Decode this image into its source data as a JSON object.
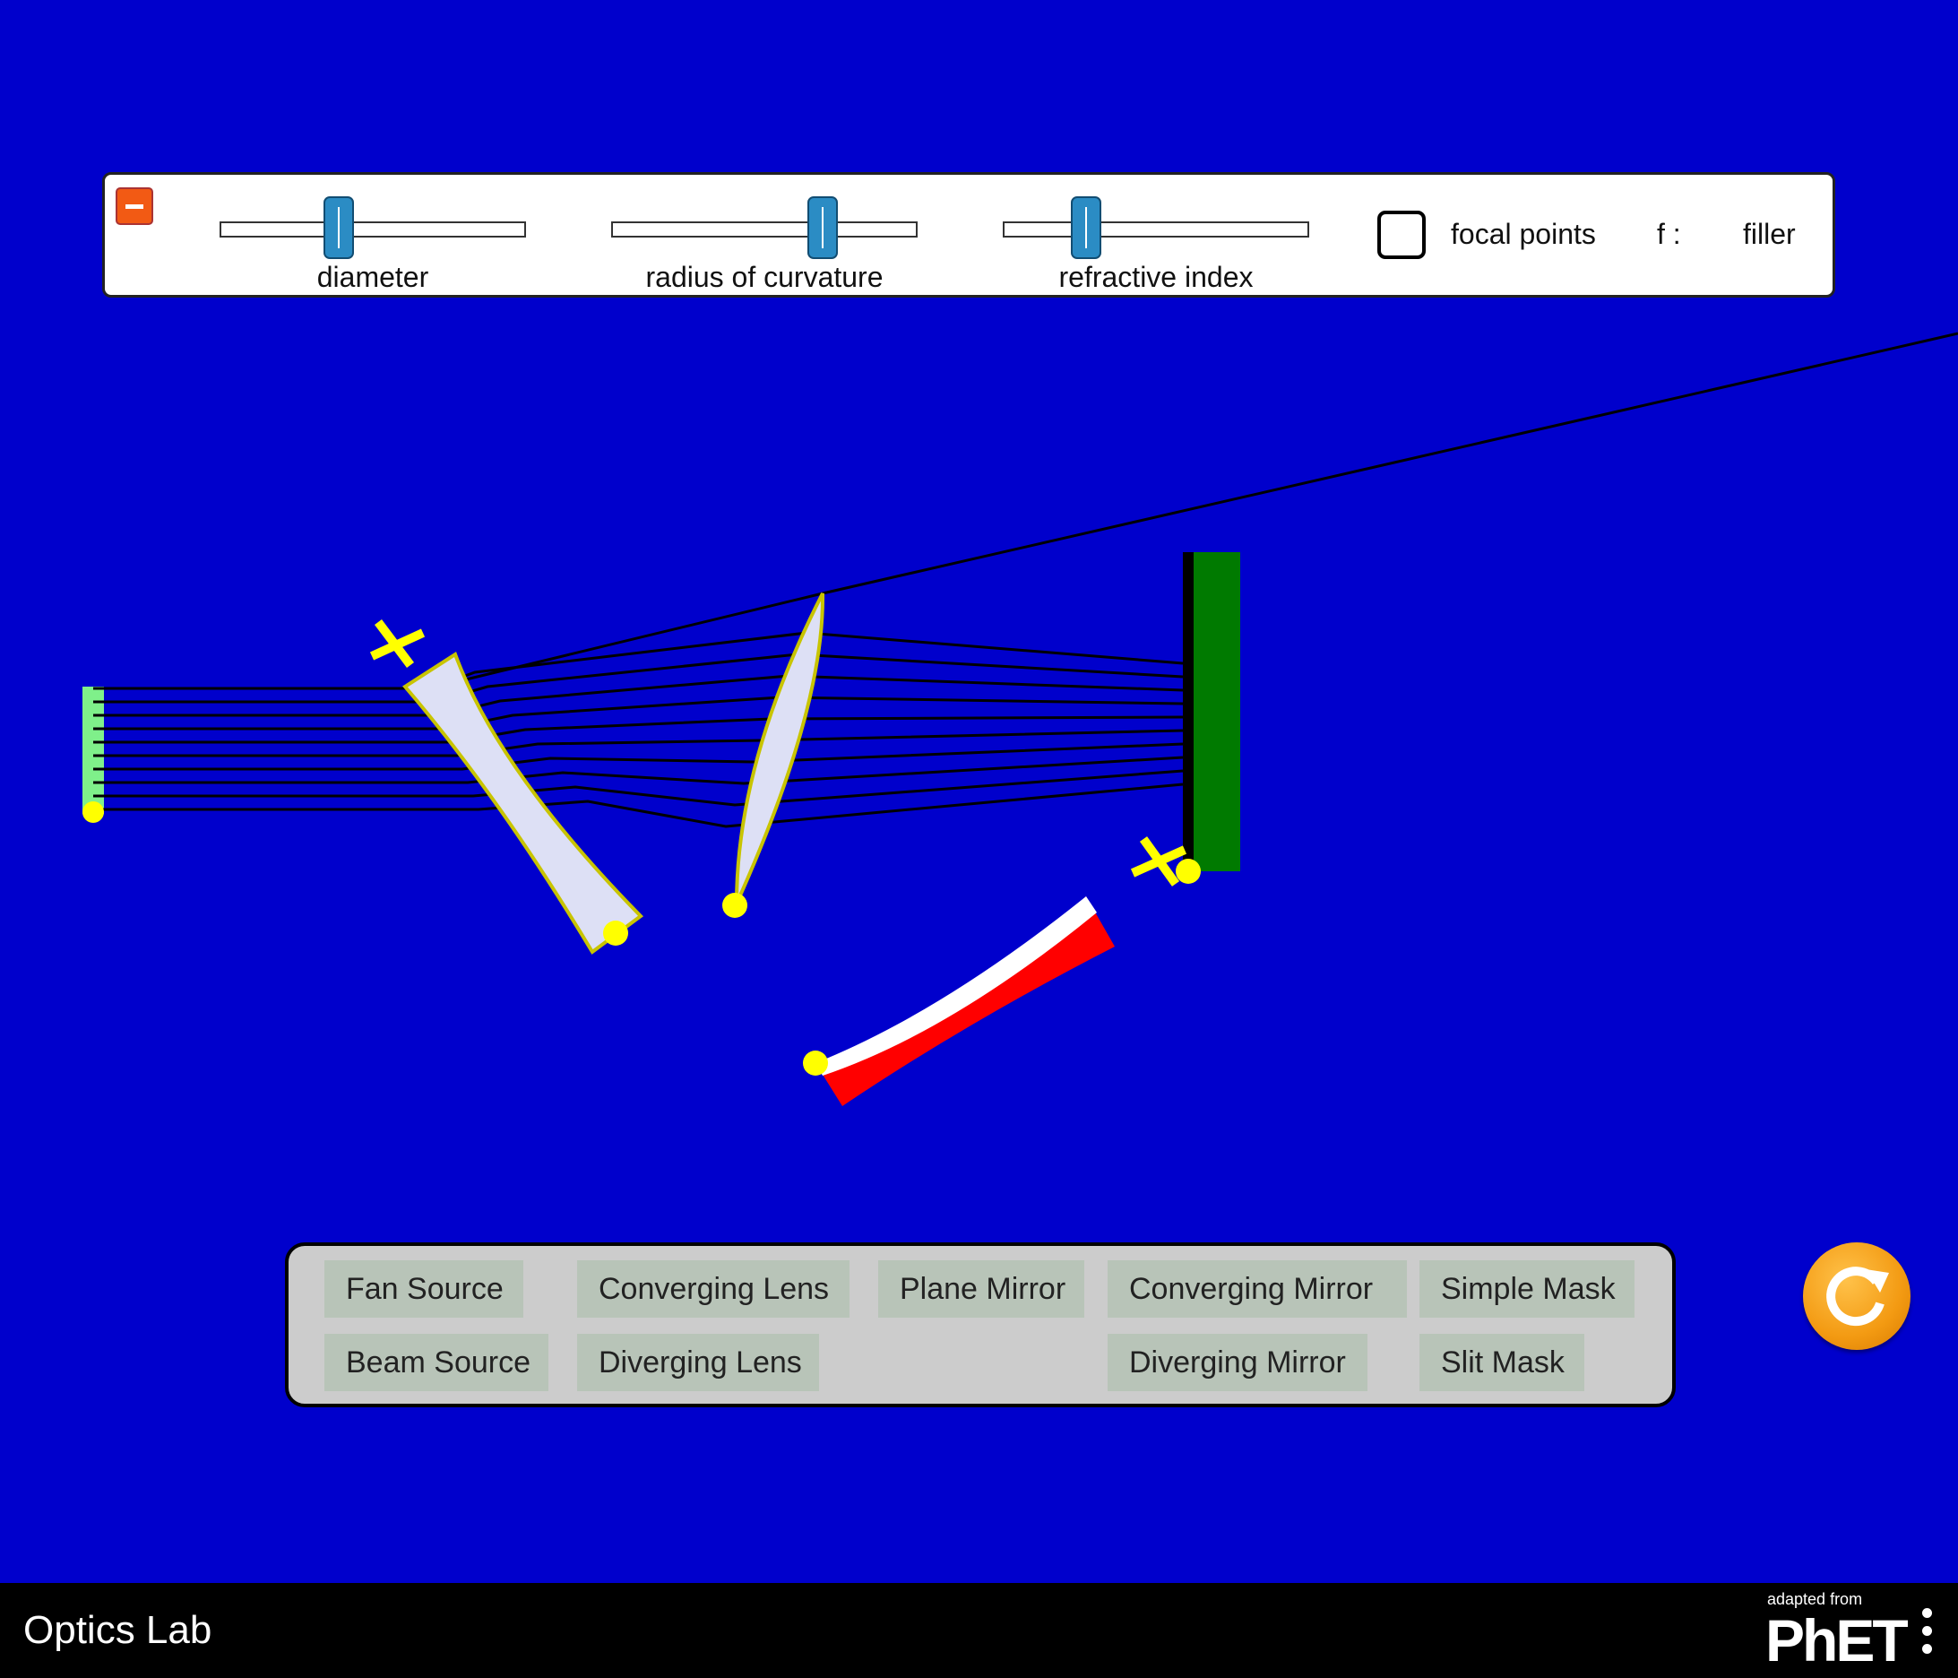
{
  "app": {
    "title": "Optics Lab"
  },
  "control_panel": {
    "sliders": [
      {
        "label": "diameter",
        "value": 0.38
      },
      {
        "label": "radius of curvature",
        "value": 0.72
      },
      {
        "label": "refractive index",
        "value": 0.25
      }
    ],
    "focal_points": {
      "label": "focal points",
      "checked": false
    },
    "f_label": "f :",
    "f_value": "filler"
  },
  "toolbox": {
    "fan_source": "Fan Source",
    "beam_source": "Beam Source",
    "converging_lens": "Converging Lens",
    "diverging_lens": "Diverging Lens",
    "plane_mirror": "Plane Mirror",
    "converging_mirror": "Converging Mirror",
    "diverging_mirror": "Diverging Mirror",
    "simple_mask": "Simple Mask",
    "slit_mask": "Slit Mask"
  },
  "footer": {
    "adapted_from": "adapted from",
    "brand": "PhET"
  },
  "colors": {
    "background": "#0000cc",
    "lens_fill": "#dde0f5",
    "lens_stroke": "#c8c400",
    "handle": "#ffff00",
    "beam_source": "#7ff08a",
    "screen": "#007a00",
    "mirror_front": "#ffffff",
    "mirror_back": "#ff0000",
    "reset": "#f39a12"
  }
}
